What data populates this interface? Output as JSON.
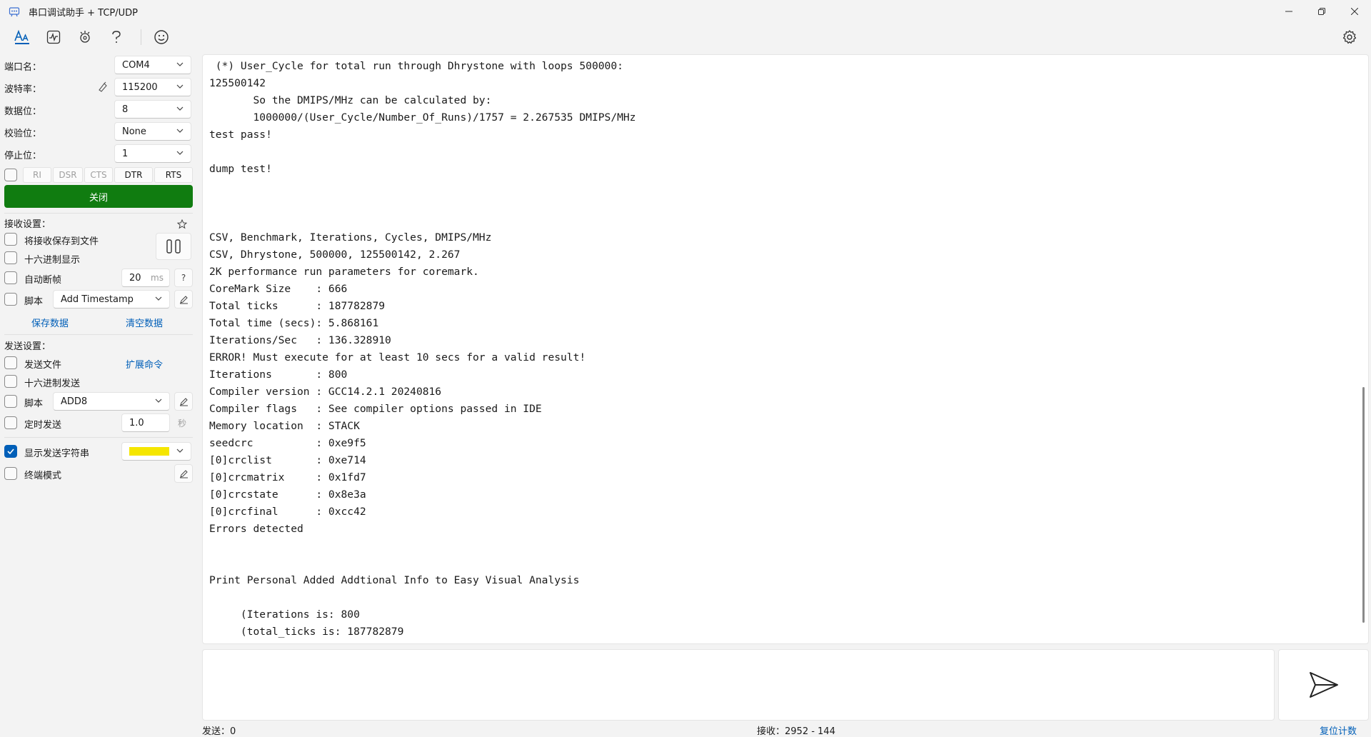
{
  "window": {
    "title": "串口调试助手 + TCP/UDP"
  },
  "toolbar": {
    "icons": [
      "text-mode-icon",
      "waveform-icon",
      "plugin-icon",
      "help-icon",
      "emoji-icon",
      "settings-icon"
    ]
  },
  "serial": {
    "port_label": "端口名：",
    "port_value": "COM4",
    "baud_label": "波特率：",
    "baud_value": "115200",
    "databits_label": "数据位：",
    "databits_value": "8",
    "parity_label": "校验位：",
    "parity_value": "None",
    "stopbits_label": "停止位：",
    "stopbits_value": "1",
    "signals": [
      "RI",
      "DSR",
      "CTS",
      "DTR",
      "RTS"
    ],
    "close_label": "关闭"
  },
  "receive_settings": {
    "header": "接收设置：",
    "save_to_file": "将接收保存到文件",
    "hex_display": "十六进制显示",
    "auto_frame": "自动断帧",
    "auto_frame_value": "20",
    "auto_frame_unit": "ms",
    "script_label": "脚本",
    "script_value": "Add Timestamp",
    "save_data": "保存数据",
    "clear_data": "清空数据"
  },
  "send_settings": {
    "header": "发送设置：",
    "send_file": "发送文件",
    "ext_cmd": "扩展命令",
    "hex_send": "十六进制发送",
    "script_label": "脚本",
    "script_value": "ADD8",
    "timed_send": "定时发送",
    "timed_value": "1.0",
    "timed_unit": "秒",
    "show_send": "显示发送字符串",
    "terminal_mode": "终端模式",
    "highlight_color": "#f5e600"
  },
  "receive_lines": [
    " (*) User_Cycle for total run through Dhrystone with loops 500000:",
    "125500142",
    "       So the DMIPS/MHz can be calculated by:",
    "       1000000/(User_Cycle/Number_Of_Runs)/1757 = 2.267535 DMIPS/MHz",
    "test pass!",
    "",
    "dump test!",
    "",
    "",
    "",
    "CSV, Benchmark, Iterations, Cycles, DMIPS/MHz",
    "CSV, Dhrystone, 500000, 125500142, 2.267",
    "2K performance run parameters for coremark.",
    "CoreMark Size    : 666",
    "Total ticks      : 187782879",
    "Total time (secs): 5.868161",
    "Iterations/Sec   : 136.328910",
    "ERROR! Must execute for at least 10 secs for a valid result!",
    "Iterations       : 800",
    "Compiler version : GCC14.2.1 20240816",
    "Compiler flags   : See compiler options passed in IDE",
    "Memory location  : STACK",
    "seedcrc          : 0xe9f5",
    "[0]crclist       : 0xe714",
    "[0]crcmatrix     : 0x1fd7",
    "[0]crcstate      : 0x8e3a",
    "[0]crcfinal      : 0xcc42",
    "Errors detected",
    "",
    "",
    "Print Personal Added Addtional Info to Easy Visual Analysis",
    "",
    "     (Iterations is: 800",
    "     (total_ticks is: 187782879"
  ],
  "status": {
    "sent": "发送：0",
    "received": "接收：2952 - 144",
    "reset": "复位计数"
  }
}
